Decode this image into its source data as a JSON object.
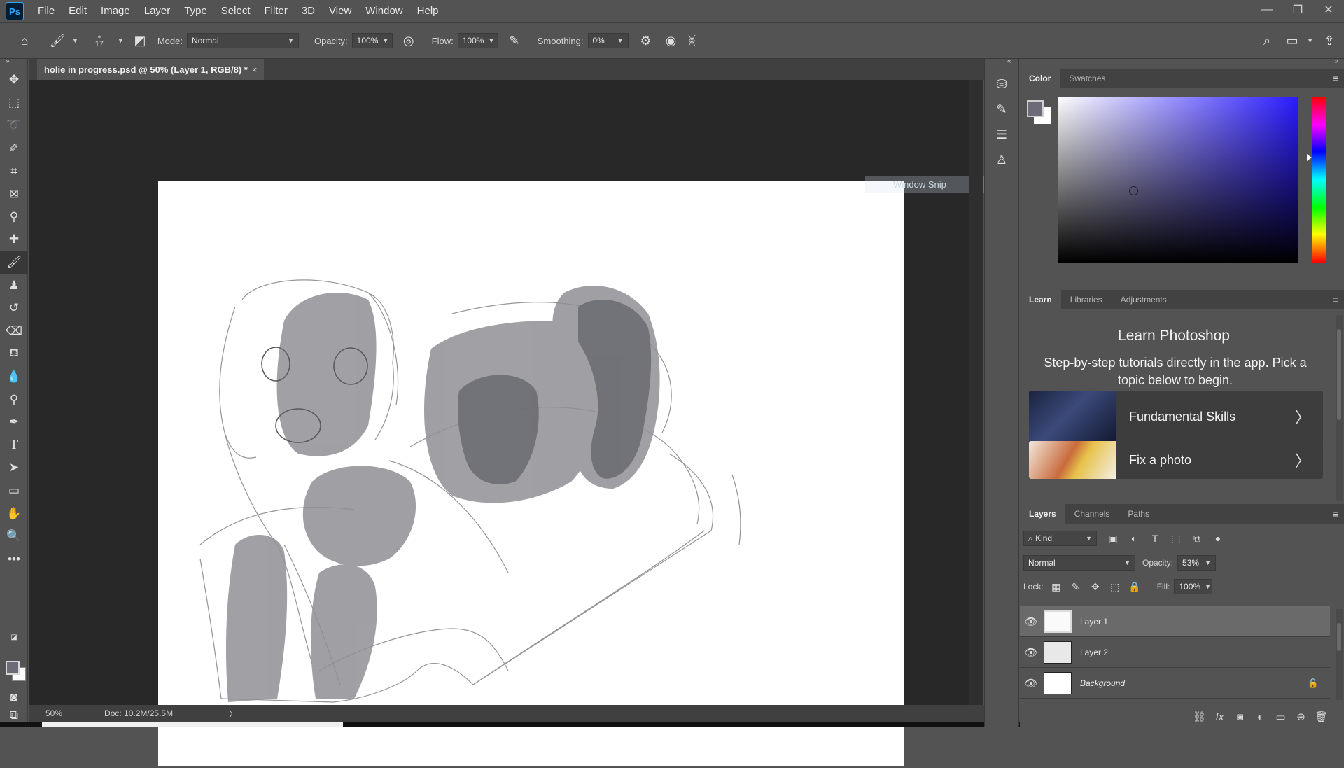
{
  "app": {
    "logo_text": "Ps",
    "menu": [
      "File",
      "Edit",
      "Image",
      "Layer",
      "Type",
      "Select",
      "Filter",
      "3D",
      "View",
      "Window",
      "Help"
    ],
    "window_controls": {
      "minimize": "—",
      "restore": "❐",
      "close": "✕"
    }
  },
  "options": {
    "brush_size": "17",
    "mode_label": "Mode:",
    "mode_value": "Normal",
    "opacity_label": "Opacity:",
    "opacity_value": "100%",
    "flow_label": "Flow:",
    "flow_value": "100%",
    "smoothing_label": "Smoothing:",
    "smoothing_value": "0%"
  },
  "document": {
    "tab_title": "holie in progress.psd @ 50% (Layer 1, RGB/8) *",
    "tab_close": "×",
    "zoom": "50%",
    "doc_size": "Doc: 10.2M/25.5M",
    "status_arrow": "〉",
    "overlay_hint": "Window Snip"
  },
  "color_panel": {
    "tabs": [
      "Color",
      "Swatches"
    ],
    "foreground": "#6c6b77",
    "background": "#ffffff",
    "hue_color": "#2a1bff"
  },
  "learn_panel": {
    "tabs": [
      "Learn",
      "Libraries",
      "Adjustments"
    ],
    "title": "Learn Photoshop",
    "subtitle": "Step-by-step tutorials directly in the app. Pick a topic below to begin.",
    "cards": [
      {
        "label": "Fundamental Skills",
        "arrow": "〉"
      },
      {
        "label": "Fix a photo",
        "arrow": "〉"
      }
    ]
  },
  "layers_panel": {
    "tabs": [
      "Layers",
      "Channels",
      "Paths"
    ],
    "filter_kind": "Kind",
    "blend_mode": "Normal",
    "opacity_label": "Opacity:",
    "opacity_value": "53%",
    "lock_label": "Lock:",
    "fill_label": "Fill:",
    "fill_value": "100%",
    "layers": [
      {
        "name": "Layer 1",
        "selected": true,
        "italic": false,
        "locked": false
      },
      {
        "name": "Layer 2",
        "selected": false,
        "italic": false,
        "locked": false
      },
      {
        "name": "Background",
        "selected": false,
        "italic": true,
        "locked": true
      }
    ]
  }
}
